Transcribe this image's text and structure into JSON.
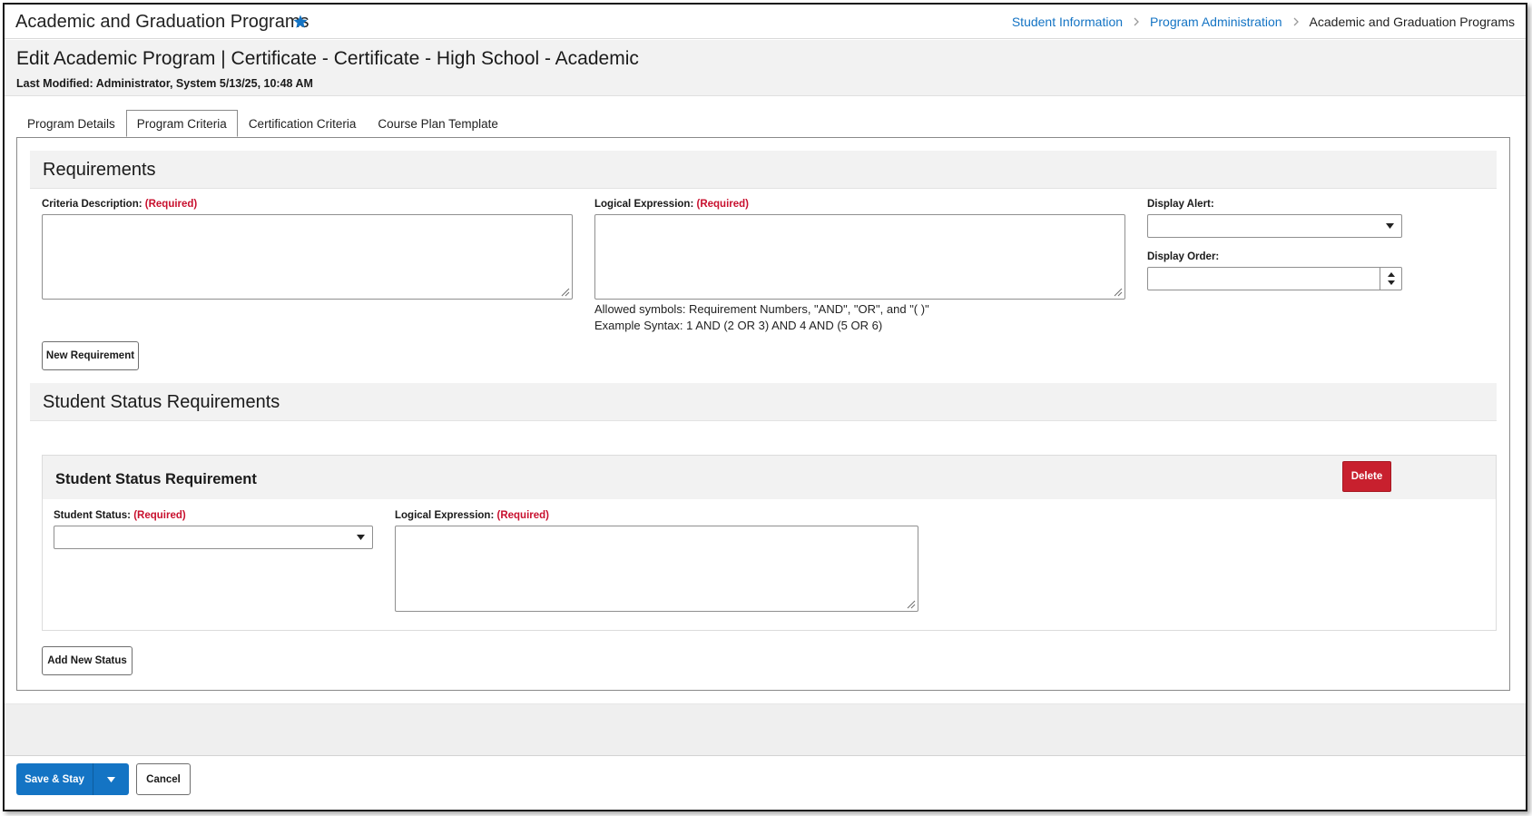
{
  "app": {
    "title": "Academic and Graduation Programs"
  },
  "breadcrumb": {
    "items": [
      "Student Information",
      "Program Administration",
      "Academic and Graduation Programs"
    ]
  },
  "header": {
    "title": "Edit Academic Program | Certificate - Certificate - High School - Academic",
    "last_modified": "Last Modified: Administrator, System 5/13/25, 10:48 AM"
  },
  "tabs": [
    {
      "label": "Program Details",
      "active": false
    },
    {
      "label": "Program Criteria",
      "active": true
    },
    {
      "label": "Certification Criteria",
      "active": false
    },
    {
      "label": "Course Plan Template",
      "active": false
    }
  ],
  "requirements": {
    "title": "Requirements",
    "criteria_label": "Criteria Description:",
    "logical_label": "Logical Expression:",
    "required_text": "(Required)",
    "display_alert_label": "Display Alert:",
    "display_alert_value": "",
    "display_order_label": "Display Order:",
    "display_order_value": "",
    "help_line1": "Allowed symbols: Requirement Numbers, \"AND\", \"OR\", and \"( )\"",
    "help_line2": "Example Syntax: 1 AND (2 OR 3) AND 4 AND (5 OR 6)",
    "new_button": "New Requirement"
  },
  "status_requirements": {
    "title": "Student Status Requirements",
    "card_title": "Student Status Requirement",
    "delete_button": "Delete",
    "status_label": "Student Status:",
    "logical_label": "Logical Expression:",
    "required_text": "(Required)",
    "status_value": "",
    "add_button": "Add New Status"
  },
  "footer": {
    "save_label": "Save & Stay",
    "cancel_label": "Cancel"
  },
  "colors": {
    "link": "#1474c4",
    "primary": "#1474c4",
    "danger": "#c8202e",
    "required": "#c8102e"
  },
  "icons": [
    "star-icon",
    "chevron-right-icon",
    "resize-grip-icon",
    "caret-down-icon",
    "caret-up-icon"
  ]
}
